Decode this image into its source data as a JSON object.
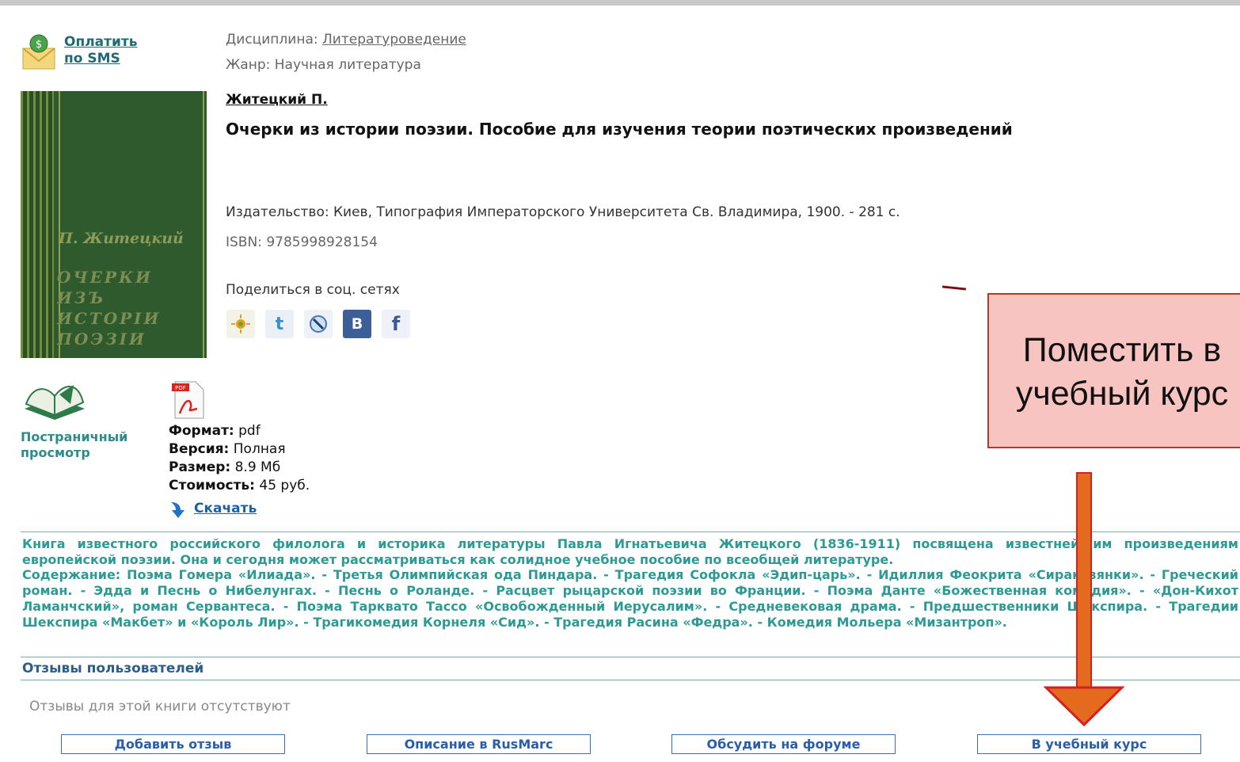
{
  "sms": {
    "line1": "Оплатить",
    "line2": "по SMS"
  },
  "meta": {
    "discipline_label": "Дисциплина:",
    "discipline_value": "Литературоведение",
    "genre": "Жанр: Научная литература"
  },
  "cover": {
    "author": "П. Житецкий",
    "title_lines": [
      "ОЧЕРКИ",
      "ИЗЪ",
      "ИСТОРІИ",
      "ПОЭЗІИ"
    ]
  },
  "book": {
    "author": "Житецкий П.",
    "title": "Очерки из истории поэзии. Пособие для изучения теории поэтических произведений",
    "publisher": "Издательство:  Киев, Типография Императорского Университета Св. Владимира, 1900. - 281 с.",
    "isbn": "ISBN: 9785998928154"
  },
  "share": {
    "label": "Поделиться в соц. сетях"
  },
  "pageview": {
    "line1": "Постраничный",
    "line2": "просмотр"
  },
  "specs": {
    "format_label": "Формат:",
    "format_value": " pdf",
    "version_label": "Версия:",
    "version_value": " Полная",
    "size_label": "Размер:",
    "size_value": " 8.9 Мб",
    "cost_label": "Стоимость:",
    "cost_value": " 45 руб."
  },
  "download": {
    "label": "Скачать"
  },
  "description": {
    "intro": "Книга известного российского филолога и историка литературы Павла Игнатьевича Житецкого (1836-1911) посвящена известнейшим произведениям европейской поэзии. Она и сегодня может рассматриваться как солидное учебное пособие по всеобщей литературе.",
    "contents": "Содержание: Поэма Гомера «Илиада». - Третья Олимпийская ода Пиндара. - Трагедия Софокла «Эдип-царь». - Идиллия Феокрита «Сиракузянки». - Греческий роман. - Эдда и Песнь о Нибелунгах. - Песнь о Роланде. - Расцвет рыцарской поэзии во Франции. - Поэма Данте «Божественная комедия». - «Дон-Кихот Ламанчский», роман Сервантеса. - Поэма Тарквато Тассо «Освобожденный Иерусалим». - Средневековая драма. - Предшественники Шекспира. - Трагедии Шекспира «Макбет» и «Король Лир». - Трагикомедия Корнеля «Сид». - Трагедия Расина «Федра». - Комедия Мольера «Мизантроп»."
  },
  "reviews": {
    "title": "Отзывы пользователей",
    "empty": "Отзывы для этой книги отсутствуют"
  },
  "buttons": {
    "add_review": "Добавить отзыв",
    "rusmarc": "Описание в RusMarc",
    "forum": "Обсудить на форуме",
    "course": "В учебный курс"
  },
  "callout": {
    "line1": "Поместить в",
    "line2": "учебный курс"
  },
  "colors": {
    "accent_teal": "#2d9a95",
    "link_blue": "#2a5ea8",
    "callout_fill": "#f8c4c1",
    "arrow": "#e46b1d"
  }
}
